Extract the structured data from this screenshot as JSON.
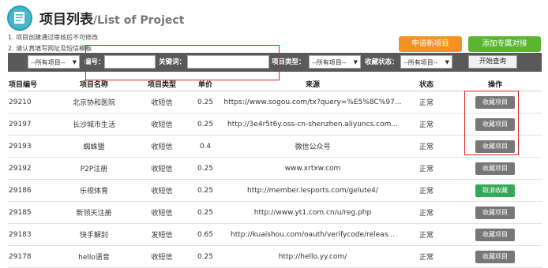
{
  "header": {
    "title": "项目列表",
    "subtitle": "/List of Project"
  },
  "notes": [
    "1. 项目创建通过审核后不可修改",
    "2. 请认真填写网址及短信模板"
  ],
  "buttons": {
    "new_project": "申请新项目",
    "add_exclusive": "添加专属对接"
  },
  "filter": {
    "category_select": "--所有项目--",
    "id_label": "编号：",
    "keyword_label": "关键词：",
    "type_label": "项目类型：",
    "type_select": "--所有项目--",
    "fav_label": "收藏状态：",
    "fav_select": "--所有项目--",
    "query_button": "开始查询"
  },
  "table": {
    "columns": [
      "项目编号",
      "项目名称",
      "项目类型",
      "单价",
      "来源",
      "状态",
      "操作"
    ],
    "rows": [
      {
        "id": "29210",
        "name": "北京协和医院",
        "type": "收短信",
        "price": "0.25",
        "source": "https://www.sogou.com/tx?query=%E5%8C%97...",
        "status": "正常",
        "action": "收藏项目",
        "action_style": "gray"
      },
      {
        "id": "29197",
        "name": "长沙城市生活",
        "type": "收短信",
        "price": "0.25",
        "source": "http://3e4r5t6y.oss-cn-shenzhen.aliyuncs.com...",
        "status": "正常",
        "action": "收藏项目",
        "action_style": "gray"
      },
      {
        "id": "29193",
        "name": "蜘蛛盟",
        "type": "收短信",
        "price": "0.4",
        "source": "微信公众号",
        "status": "正常",
        "action": "收藏项目",
        "action_style": "gray"
      },
      {
        "id": "29192",
        "name": "P2P注册",
        "type": "收短信",
        "price": "0.25",
        "source": "www.xrtxw.com",
        "status": "正常",
        "action": "收藏项目",
        "action_style": "gray"
      },
      {
        "id": "29186",
        "name": "乐视体育",
        "type": "收短信",
        "price": "0.25",
        "source": "http://member.lesports.com/gelute4/",
        "status": "正常",
        "action": "取消收藏",
        "action_style": "green"
      },
      {
        "id": "29185",
        "name": "新领天注册",
        "type": "收短信",
        "price": "0.25",
        "source": "http://www.yt1.com.cn/u/reg.php",
        "status": "正常",
        "action": "收藏项目",
        "action_style": "gray"
      },
      {
        "id": "29183",
        "name": "快手解封",
        "type": "发短信",
        "price": "0.65",
        "source": "http://kuaishou.com/oauth/verifycode/releas...",
        "status": "正常",
        "action": "收藏项目",
        "action_style": "gray"
      },
      {
        "id": "29178",
        "name": "hello语音",
        "type": "收短信",
        "price": "0.25",
        "source": "http://hello.yy.com/",
        "status": "正常",
        "action": "收藏项目",
        "action_style": "gray"
      }
    ]
  },
  "colors": {
    "accent_orange": "#f39221",
    "accent_green": "#5bb531",
    "highlight_red": "#e02020"
  }
}
